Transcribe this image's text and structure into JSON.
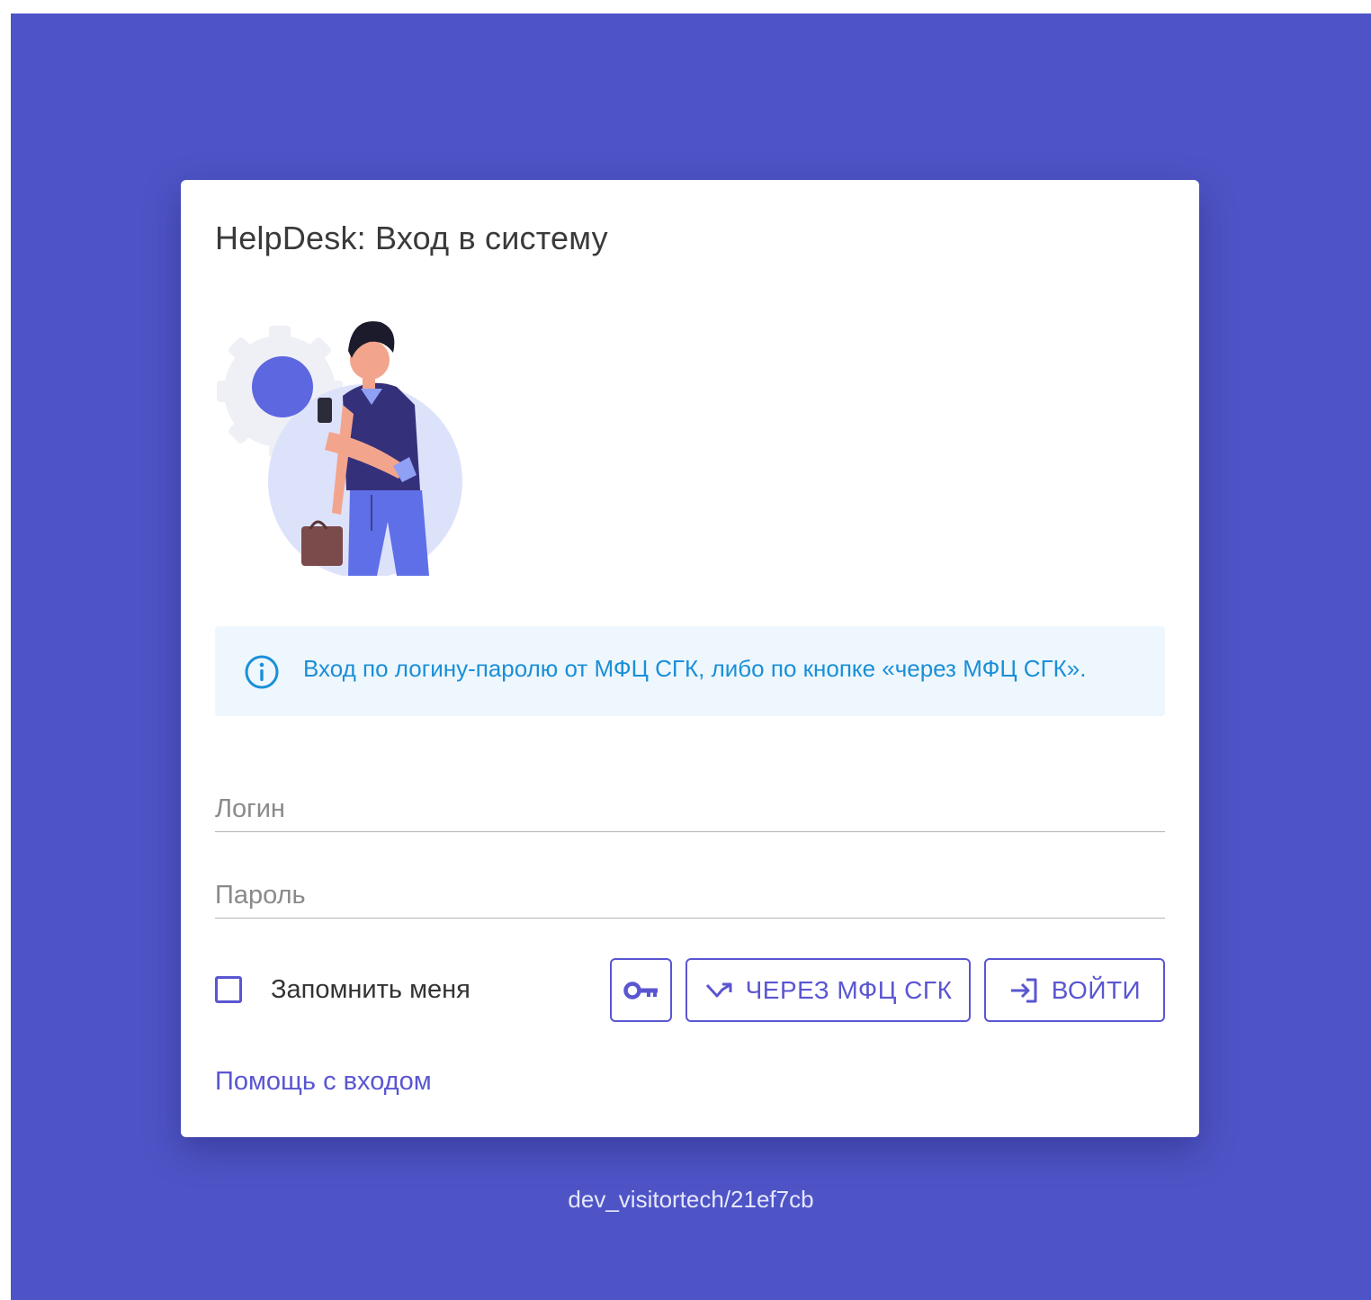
{
  "page": {
    "background_color": "#4e54c6",
    "accent_color": "#5a56d2",
    "info_color": "#1a8fd8"
  },
  "card": {
    "title": "HelpDesk: Вход в систему",
    "illustration": "person-with-phone-and-gear-illustration",
    "info": {
      "icon": "info-icon",
      "text": "Вход по логину-паролю от МФЦ СГК, либо по кнопке «через МФЦ СГК»."
    },
    "form": {
      "login_placeholder": "Логин",
      "login_value": "",
      "password_placeholder": "Пароль",
      "password_value": "",
      "remember_label": "Запомнить меня",
      "remember_checked": false
    },
    "buttons": {
      "key_icon": "key-icon",
      "mfc_icon": "arrow-swap-icon",
      "mfc_label": "ЧЕРЕЗ МФЦ СГК",
      "login_icon": "sign-in-icon",
      "login_label": "ВОЙТИ"
    },
    "help_link": "Помощь с входом"
  },
  "footer": {
    "version": "dev_visitortech/21ef7cb"
  }
}
